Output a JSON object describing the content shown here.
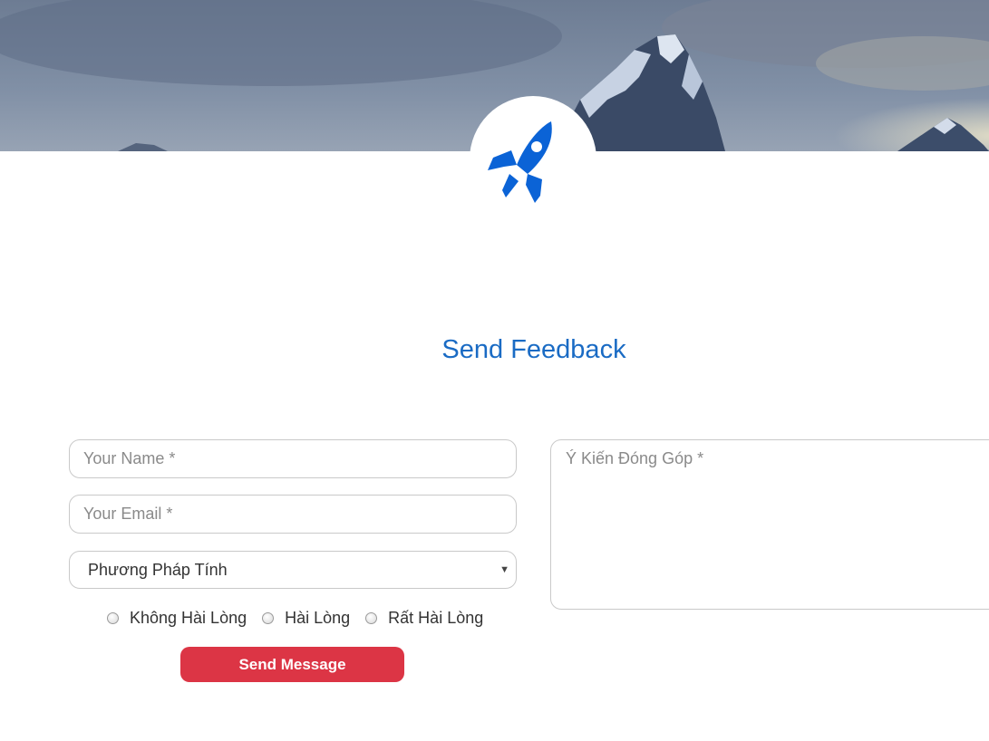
{
  "header": {
    "banner_image": "mountain-sky-photo",
    "logo_icon": "rocket-icon",
    "accent_color": "#1a6bc4"
  },
  "main": {
    "title": "Send Feedback"
  },
  "form": {
    "name_placeholder": "Your Name *",
    "email_placeholder": "Your Email *",
    "method_select": {
      "selected": "Phương Pháp Tính",
      "arrow_icon": "caret-down-icon"
    },
    "feedback_placeholder": "Ý Kiến Đóng Góp *",
    "rating_options": [
      {
        "label": "Không Hài Lòng",
        "checked": false
      },
      {
        "label": "Hài Lòng",
        "checked": false
      },
      {
        "label": "Rất Hài Lòng",
        "checked": false
      }
    ],
    "submit_label": "Send Message",
    "submit_color": "#dc3545"
  }
}
